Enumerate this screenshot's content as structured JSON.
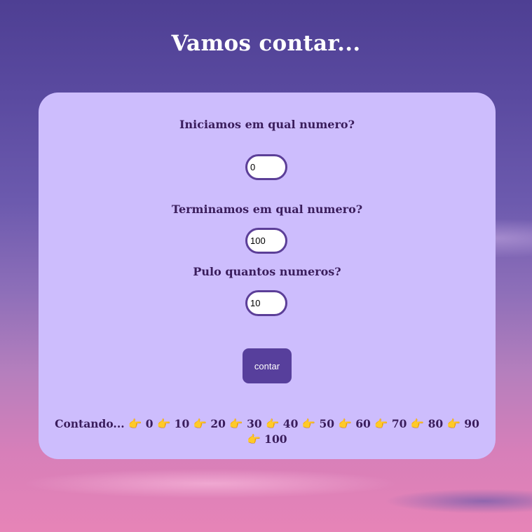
{
  "header": {
    "title": "Vamos contar..."
  },
  "form": {
    "start_label": "Iniciamos em qual numero?",
    "start_value": "0",
    "end_label": "Terminamos em qual numero?",
    "end_value": "100",
    "step_label": "Pulo quantos numeros?",
    "step_value": "10",
    "submit_label": "contar"
  },
  "result": {
    "prefix": "Contando...",
    "icon": "pointing-right-icon",
    "icon_glyph": "👉",
    "numbers": [
      "0",
      "10",
      "20",
      "30",
      "40",
      "50",
      "60",
      "70",
      "80",
      "90",
      "100"
    ]
  }
}
